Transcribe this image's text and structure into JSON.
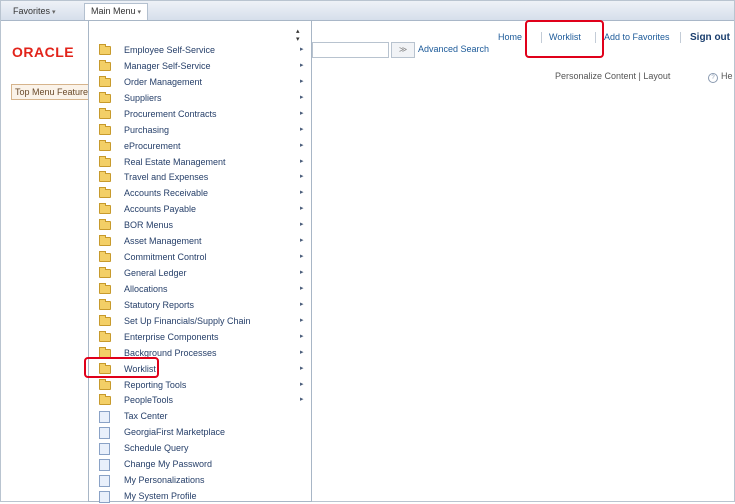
{
  "topbar": {
    "favorites": "Favorites",
    "main_menu": "Main Menu"
  },
  "header": {
    "logo": "ORACLE",
    "advanced_search": "Advanced Search",
    "search_go": "≫",
    "nav": {
      "home": "Home",
      "worklist": "Worklist",
      "add_to_favorites": "Add to Favorites",
      "sign_out": "Sign out"
    },
    "personalize": "Personalize Content | Layout",
    "help": "He"
  },
  "side_tab": "Top Menu Features",
  "menu": {
    "items": [
      {
        "label": "Employee Self-Service",
        "icon": "folder-icon",
        "submenu": true
      },
      {
        "label": "Manager Self-Service",
        "icon": "folder-icon",
        "submenu": true
      },
      {
        "label": "Order Management",
        "icon": "folder-icon",
        "submenu": true
      },
      {
        "label": "Suppliers",
        "icon": "folder-icon",
        "submenu": true
      },
      {
        "label": "Procurement Contracts",
        "icon": "folder-icon",
        "submenu": true
      },
      {
        "label": "Purchasing",
        "icon": "folder-icon",
        "submenu": true
      },
      {
        "label": "eProcurement",
        "icon": "folder-icon",
        "submenu": true
      },
      {
        "label": "Real Estate Management",
        "icon": "folder-icon",
        "submenu": true
      },
      {
        "label": "Travel and Expenses",
        "icon": "folder-icon",
        "submenu": true
      },
      {
        "label": "Accounts Receivable",
        "icon": "folder-icon",
        "submenu": true
      },
      {
        "label": "Accounts Payable",
        "icon": "folder-icon",
        "submenu": true
      },
      {
        "label": "BOR Menus",
        "icon": "folder-icon",
        "submenu": true
      },
      {
        "label": "Asset Management",
        "icon": "folder-icon",
        "submenu": true
      },
      {
        "label": "Commitment Control",
        "icon": "folder-icon",
        "submenu": true
      },
      {
        "label": "General Ledger",
        "icon": "folder-icon",
        "submenu": true
      },
      {
        "label": "Allocations",
        "icon": "folder-icon",
        "submenu": true
      },
      {
        "label": "Statutory Reports",
        "icon": "folder-icon",
        "submenu": true
      },
      {
        "label": "Set Up Financials/Supply Chain",
        "icon": "folder-icon",
        "submenu": true
      },
      {
        "label": "Enterprise Components",
        "icon": "folder-icon",
        "submenu": true
      },
      {
        "label": "Background Processes",
        "icon": "folder-icon",
        "submenu": true
      },
      {
        "label": "Worklist",
        "icon": "folder-icon",
        "submenu": true
      },
      {
        "label": "Reporting Tools",
        "icon": "folder-icon",
        "submenu": true
      },
      {
        "label": "PeopleTools",
        "icon": "folder-icon",
        "submenu": true
      },
      {
        "label": "Tax Center",
        "icon": "page-icon",
        "submenu": false
      },
      {
        "label": "GeorgiaFirst Marketplace",
        "icon": "page-icon",
        "submenu": false
      },
      {
        "label": "Schedule Query",
        "icon": "page-icon",
        "submenu": false
      },
      {
        "label": "Change My Password",
        "icon": "page-icon",
        "submenu": false
      },
      {
        "label": "My Personalizations",
        "icon": "page-icon",
        "submenu": false
      },
      {
        "label": "My System Profile",
        "icon": "page-icon",
        "submenu": false
      }
    ]
  },
  "highlight_color": "#e0001a"
}
